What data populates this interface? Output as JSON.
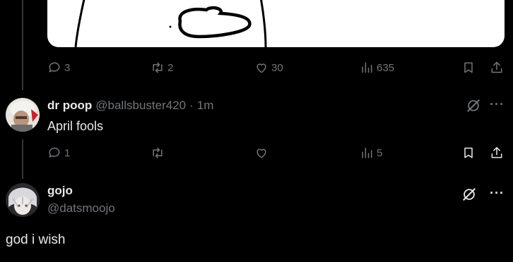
{
  "post1": {
    "replies": "3",
    "reposts": "2",
    "likes": "30",
    "views": "635"
  },
  "reply": {
    "name": "dr poop",
    "handle": "@ballsbuster420",
    "separator": "·",
    "time": "1m",
    "text": "April fools",
    "replies": "1",
    "reposts": "",
    "likes": "",
    "views": "5"
  },
  "composer": {
    "name": "gojo",
    "handle": "@datsmoojo",
    "text": "god i wish"
  },
  "colors": {
    "background": "#000000",
    "muted": "#71767b",
    "text": "#e7e9ea",
    "line": "#333639"
  },
  "icons": [
    "reply-icon",
    "repost-icon",
    "like-icon",
    "views-icon",
    "bookmark-icon",
    "share-icon",
    "grok-icon",
    "more-icon"
  ]
}
